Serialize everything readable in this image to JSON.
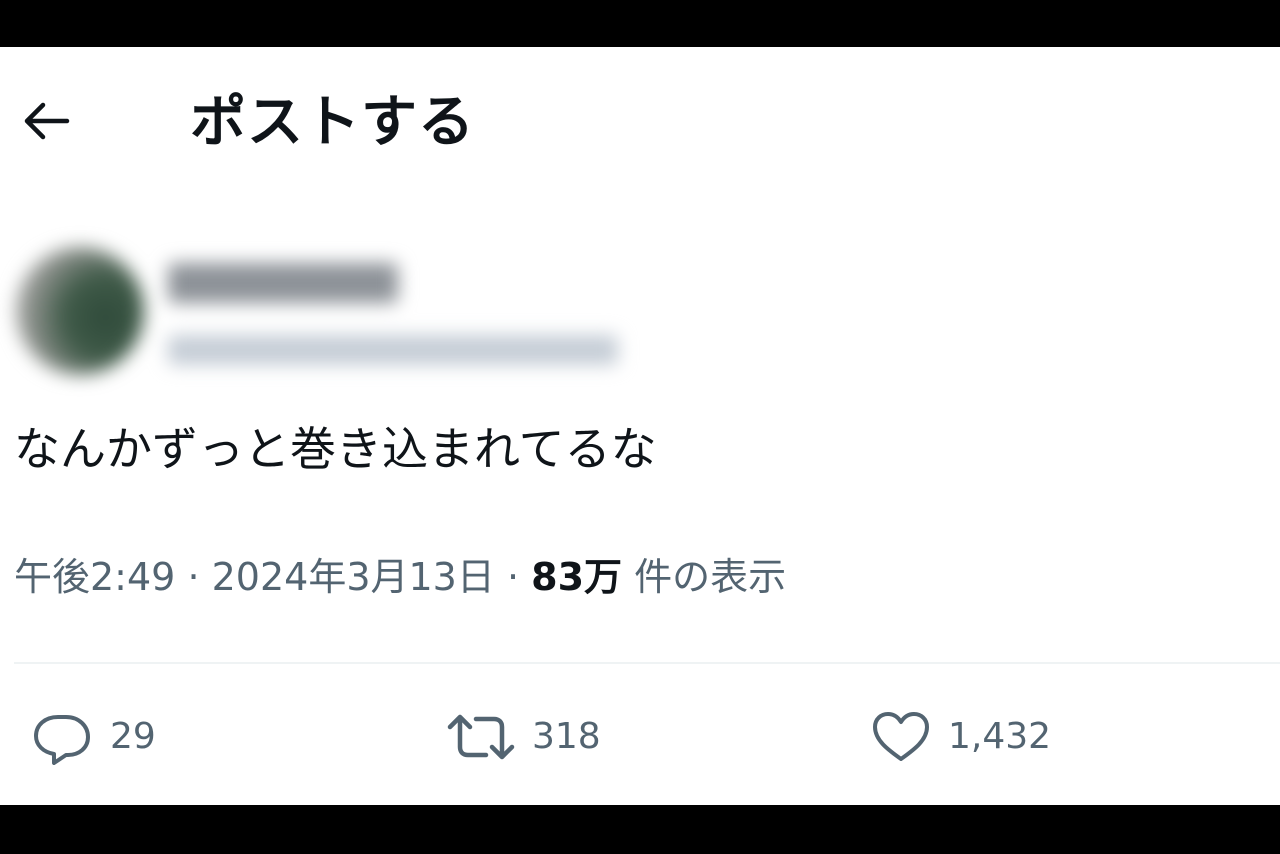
{
  "header": {
    "back_icon": "arrow-left-icon",
    "title": "ポストする"
  },
  "tweet": {
    "text": "なんかずっと巻き込まれてるな",
    "time": "午後2:49",
    "separator": "·",
    "date": "2024年3月13日",
    "views_count": "83万",
    "views_label": "件の表示"
  },
  "actions": {
    "reply": {
      "icon": "reply-icon",
      "count": "29"
    },
    "retweet": {
      "icon": "retweet-icon",
      "count": "318"
    },
    "like": {
      "icon": "heart-icon",
      "count": "1,432"
    }
  },
  "colors": {
    "text_primary": "#0f1419",
    "text_secondary": "#536471",
    "divider": "#eff3f4"
  }
}
